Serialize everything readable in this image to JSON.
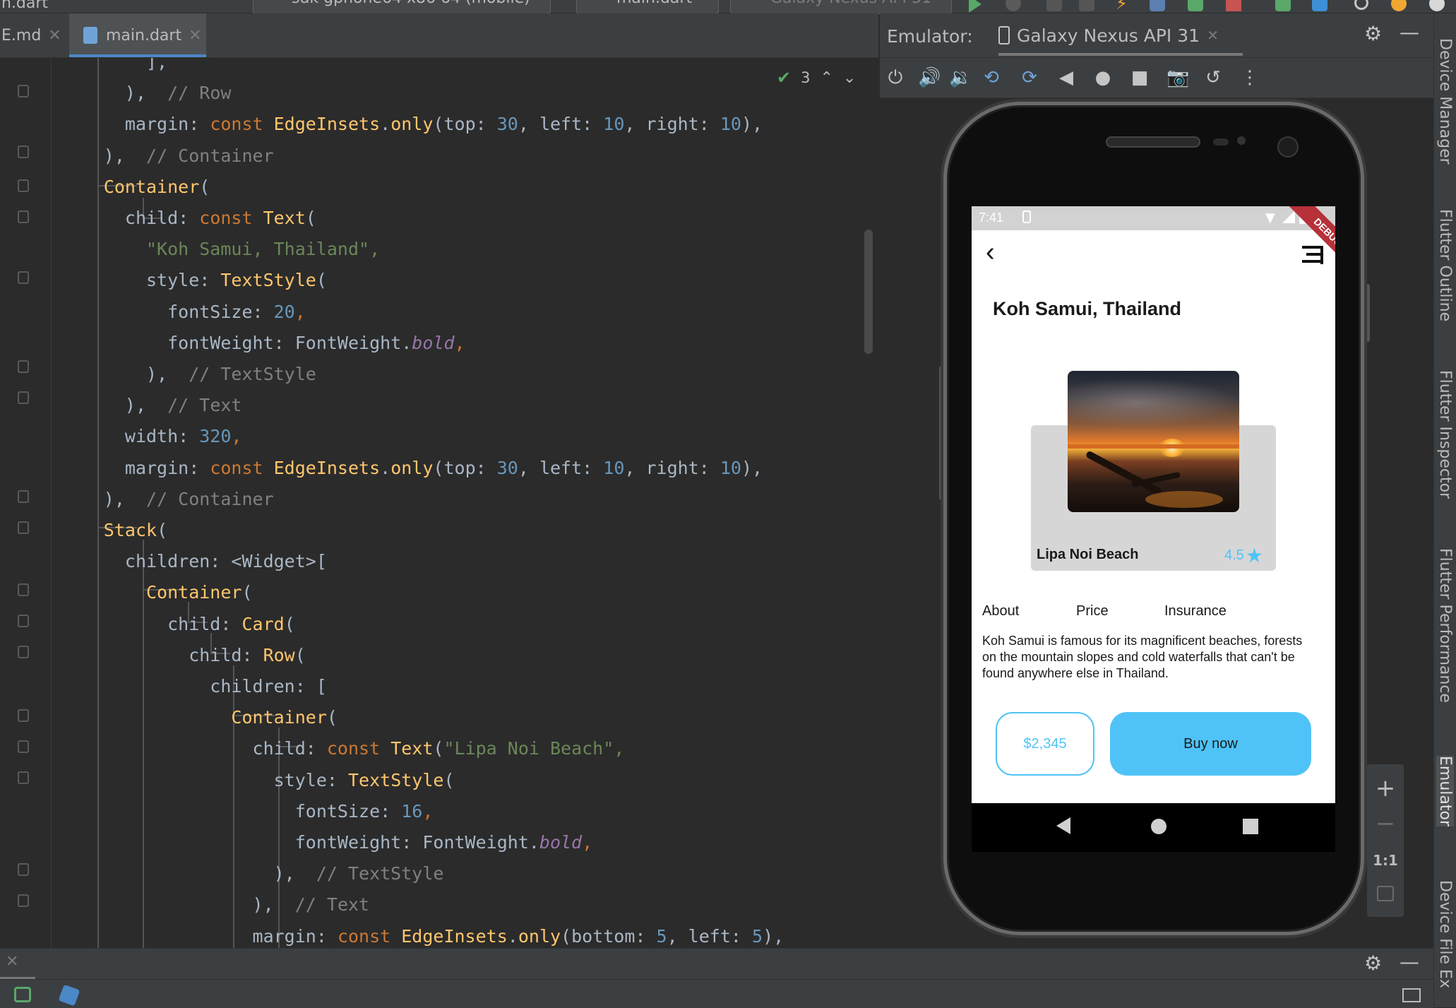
{
  "toolbar": {
    "open_file_title": "n.dart",
    "device_selector": "sdk gphone64 x86 64 (mobile)",
    "run_config": "main.dart",
    "avd_selector": "Galaxy Nexus API 31"
  },
  "editor_tabs": [
    {
      "label": "E.md"
    },
    {
      "label": "main.dart"
    }
  ],
  "inspection": {
    "count": "3"
  },
  "emulator": {
    "panel_label": "Emulator:",
    "device_tab": "Galaxy Nexus API 31"
  },
  "right_tool_windows": [
    "Device Manager",
    "Flutter Outline",
    "Flutter Inspector",
    "Flutter Performance",
    "Emulator",
    "Device File Ex"
  ],
  "zoom": {
    "plus": "+",
    "minus": "−",
    "one_to_one": "1:1"
  },
  "app": {
    "status_time": "7:41",
    "debug_banner": "DEBUG",
    "title": "Koh Samui, Thailand",
    "card_title": "Lipa Noi Beach",
    "rating": "4.5",
    "tabs": [
      "About",
      "Price",
      "Insurance"
    ],
    "description": "Koh Samui is famous for its magnificent beaches, forests on the mountain slopes and cold waterfalls that can't be found anywhere else in Thailand.",
    "price_button": "$2,345",
    "buy_button": "Buy now"
  },
  "colors": {
    "accent": "#4fc3f7",
    "tab_underline": "#4a88c7",
    "keyword": "#cc7832",
    "class": "#ffc66d",
    "string": "#6a8759",
    "number": "#6897bb",
    "comment": "#808080"
  },
  "code_lines": [
    [
      {
        "t": "    ],",
        "c": "plain"
      }
    ],
    [
      {
        "t": "  ),  ",
        "c": "plain"
      },
      {
        "t": "// Row",
        "c": "cmt"
      }
    ],
    [
      {
        "t": "  margin: ",
        "c": "plain"
      },
      {
        "t": "const ",
        "c": "kw"
      },
      {
        "t": "EdgeInsets",
        "c": "cls"
      },
      {
        "t": ".",
        "c": "plain"
      },
      {
        "t": "only",
        "c": "cls"
      },
      {
        "t": "(top: ",
        "c": "plain"
      },
      {
        "t": "30",
        "c": "num"
      },
      {
        "t": ", left: ",
        "c": "plain"
      },
      {
        "t": "10",
        "c": "num"
      },
      {
        "t": ", right: ",
        "c": "plain"
      },
      {
        "t": "10",
        "c": "num"
      },
      {
        "t": "),",
        "c": "plain"
      }
    ],
    [
      {
        "t": "),  ",
        "c": "plain"
      },
      {
        "t": "// Container",
        "c": "cmt"
      }
    ],
    [
      {
        "t": "Container",
        "c": "cls"
      },
      {
        "t": "(",
        "c": "plain"
      }
    ],
    [
      {
        "t": "  child: ",
        "c": "plain"
      },
      {
        "t": "const ",
        "c": "kw"
      },
      {
        "t": "Text",
        "c": "cls"
      },
      {
        "t": "(",
        "c": "plain"
      }
    ],
    [
      {
        "t": "    \"Koh Samui, Thailand\",",
        "c": "str"
      }
    ],
    [
      {
        "t": "    style: ",
        "c": "plain"
      },
      {
        "t": "TextStyle",
        "c": "cls"
      },
      {
        "t": "(",
        "c": "plain"
      }
    ],
    [
      {
        "t": "      fontSize: ",
        "c": "plain"
      },
      {
        "t": "20",
        "c": "num"
      },
      {
        "t": ",",
        "c": "kw"
      }
    ],
    [
      {
        "t": "      fontWeight: FontWeight.",
        "c": "plain"
      },
      {
        "t": "bold",
        "c": "prop"
      },
      {
        "t": ",",
        "c": "kw"
      }
    ],
    [
      {
        "t": "    ),  ",
        "c": "plain"
      },
      {
        "t": "// TextStyle",
        "c": "cmt"
      }
    ],
    [
      {
        "t": "  ),  ",
        "c": "plain"
      },
      {
        "t": "// Text",
        "c": "cmt"
      }
    ],
    [
      {
        "t": "  width: ",
        "c": "plain"
      },
      {
        "t": "320",
        "c": "num"
      },
      {
        "t": ",",
        "c": "kw"
      }
    ],
    [
      {
        "t": "  margin: ",
        "c": "plain"
      },
      {
        "t": "const ",
        "c": "kw"
      },
      {
        "t": "EdgeInsets",
        "c": "cls"
      },
      {
        "t": ".",
        "c": "plain"
      },
      {
        "t": "only",
        "c": "cls"
      },
      {
        "t": "(top: ",
        "c": "plain"
      },
      {
        "t": "30",
        "c": "num"
      },
      {
        "t": ", left: ",
        "c": "plain"
      },
      {
        "t": "10",
        "c": "num"
      },
      {
        "t": ", right: ",
        "c": "plain"
      },
      {
        "t": "10",
        "c": "num"
      },
      {
        "t": "),",
        "c": "plain"
      }
    ],
    [
      {
        "t": "),  ",
        "c": "plain"
      },
      {
        "t": "// Container",
        "c": "cmt"
      }
    ],
    [
      {
        "t": "Stack",
        "c": "cls"
      },
      {
        "t": "(",
        "c": "plain"
      }
    ],
    [
      {
        "t": "  children: <Widget>[",
        "c": "plain"
      }
    ],
    [
      {
        "t": "    Container",
        "c": "cls"
      },
      {
        "t": "(",
        "c": "plain"
      }
    ],
    [
      {
        "t": "      child: ",
        "c": "plain"
      },
      {
        "t": "Card",
        "c": "cls"
      },
      {
        "t": "(",
        "c": "plain"
      }
    ],
    [
      {
        "t": "        child: ",
        "c": "plain"
      },
      {
        "t": "Row",
        "c": "cls"
      },
      {
        "t": "(",
        "c": "plain"
      }
    ],
    [
      {
        "t": "          children: [",
        "c": "plain"
      }
    ],
    [
      {
        "t": "            Container",
        "c": "cls"
      },
      {
        "t": "(",
        "c": "plain"
      }
    ],
    [
      {
        "t": "              child: ",
        "c": "plain"
      },
      {
        "t": "const ",
        "c": "kw"
      },
      {
        "t": "Text",
        "c": "cls"
      },
      {
        "t": "(",
        "c": "plain"
      },
      {
        "t": "\"Lipa Noi Beach\",",
        "c": "str"
      }
    ],
    [
      {
        "t": "                style: ",
        "c": "plain"
      },
      {
        "t": "TextStyle",
        "c": "cls"
      },
      {
        "t": "(",
        "c": "plain"
      }
    ],
    [
      {
        "t": "                  fontSize: ",
        "c": "plain"
      },
      {
        "t": "16",
        "c": "num"
      },
      {
        "t": ",",
        "c": "kw"
      }
    ],
    [
      {
        "t": "                  fontWeight: FontWeight.",
        "c": "plain"
      },
      {
        "t": "bold",
        "c": "prop"
      },
      {
        "t": ",",
        "c": "kw"
      }
    ],
    [
      {
        "t": "                ),  ",
        "c": "plain"
      },
      {
        "t": "// TextStyle",
        "c": "cmt"
      }
    ],
    [
      {
        "t": "              ),  ",
        "c": "plain"
      },
      {
        "t": "// Text",
        "c": "cmt"
      }
    ],
    [
      {
        "t": "              margin: ",
        "c": "plain"
      },
      {
        "t": "const ",
        "c": "kw"
      },
      {
        "t": "EdgeInsets",
        "c": "cls"
      },
      {
        "t": ".",
        "c": "plain"
      },
      {
        "t": "only",
        "c": "cls"
      },
      {
        "t": "(bottom: ",
        "c": "plain"
      },
      {
        "t": "5",
        "c": "num"
      },
      {
        "t": ", left: ",
        "c": "plain"
      },
      {
        "t": "5",
        "c": "num"
      },
      {
        "t": "),",
        "c": "plain"
      }
    ]
  ]
}
